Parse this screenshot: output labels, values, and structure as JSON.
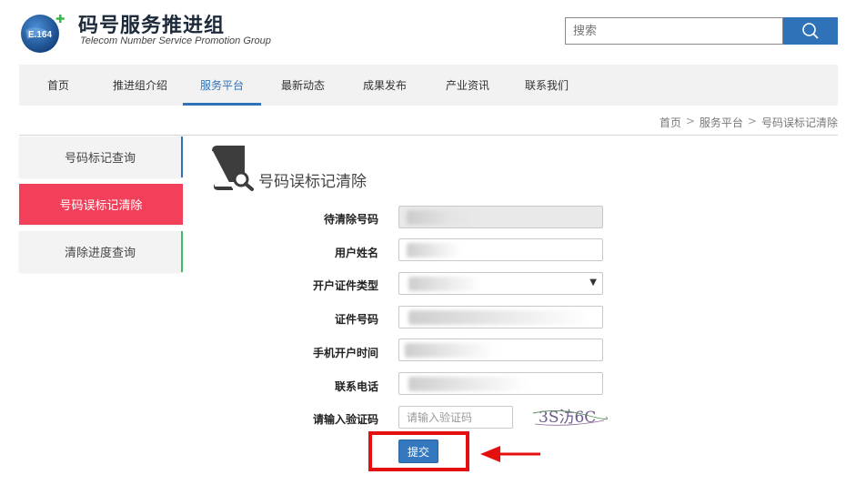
{
  "header": {
    "logo_text": "E.164",
    "title": "码号服务推进组",
    "subtitle": "Telecom Number Service  Promotion Group",
    "search_placeholder": "搜索",
    "search_icon": "search-icon"
  },
  "nav": {
    "items": [
      {
        "label": "首页",
        "active": false
      },
      {
        "label": "推进组介绍",
        "active": false
      },
      {
        "label": "服务平台",
        "active": true
      },
      {
        "label": "最新动态",
        "active": false
      },
      {
        "label": "成果发布",
        "active": false
      },
      {
        "label": "产业资讯",
        "active": false
      },
      {
        "label": "联系我们",
        "active": false
      }
    ]
  },
  "breadcrumb": {
    "items": [
      "首页",
      "服务平台",
      "号码误标记清除"
    ],
    "separator": ">"
  },
  "sidebar": {
    "items": [
      {
        "label": "号码标记查询",
        "active": false
      },
      {
        "label": "号码误标记清除",
        "active": true
      },
      {
        "label": "清除进度查询",
        "active": false
      }
    ]
  },
  "content": {
    "title": "号码误标记清除",
    "icon": "book-search-icon"
  },
  "form": {
    "fields": [
      {
        "label": "待清除号码",
        "type": "text",
        "disabled": true
      },
      {
        "label": "用户姓名",
        "type": "text",
        "disabled": false
      },
      {
        "label": "开户证件类型",
        "type": "select",
        "disabled": false
      },
      {
        "label": "证件号码",
        "type": "text",
        "disabled": false
      },
      {
        "label": "手机开户时间",
        "type": "text",
        "disabled": false
      },
      {
        "label": "联系电话",
        "type": "text",
        "disabled": false
      }
    ],
    "captcha_label": "请输入验证码",
    "captcha_placeholder": "请输入验证码",
    "captcha_text": "3S汸6C",
    "submit_label": "提交"
  },
  "colors": {
    "brand_blue": "#2f72b7",
    "sidebar_active": "#f2405a",
    "highlight_red": "#e41010",
    "sidebar_green": "#3dbb6a"
  }
}
